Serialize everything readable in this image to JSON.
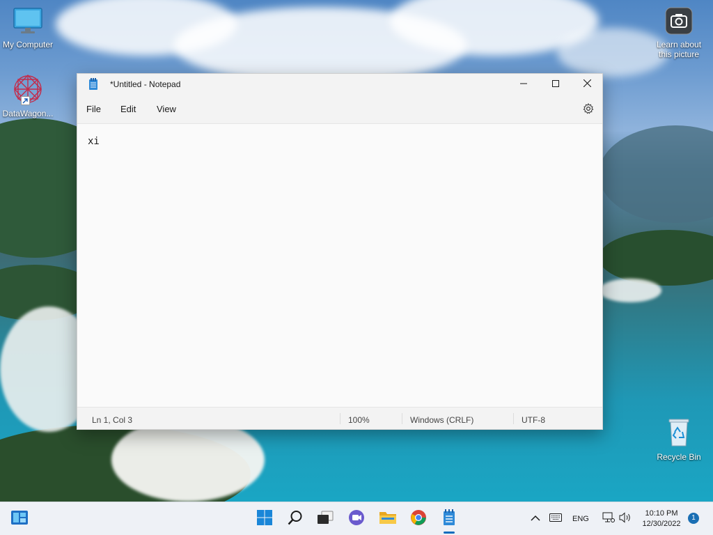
{
  "desktop": {
    "icons": [
      {
        "label": "My Computer",
        "icon": "monitor-icon"
      },
      {
        "label": "DataWagon...",
        "icon": "datawagon-icon"
      },
      {
        "label": "Learn about\nthis picture",
        "icon": "camera-icon"
      },
      {
        "label": "Recycle Bin",
        "icon": "recycle-bin-icon"
      }
    ]
  },
  "notepad": {
    "title": "*Untitled - Notepad",
    "menu": [
      "File",
      "Edit",
      "View"
    ],
    "content": "xi",
    "status": {
      "position": "Ln 1, Col 3",
      "zoom": "100%",
      "line_ending": "Windows (CRLF)",
      "encoding": "UTF-8"
    }
  },
  "taskbar": {
    "tray": {
      "language": "ENG",
      "time": "10:10 PM",
      "date": "12/30/2022",
      "notifications": "1"
    }
  },
  "colors": {
    "accent": "#0f6cbd",
    "taskbar": "#eef1f6"
  }
}
